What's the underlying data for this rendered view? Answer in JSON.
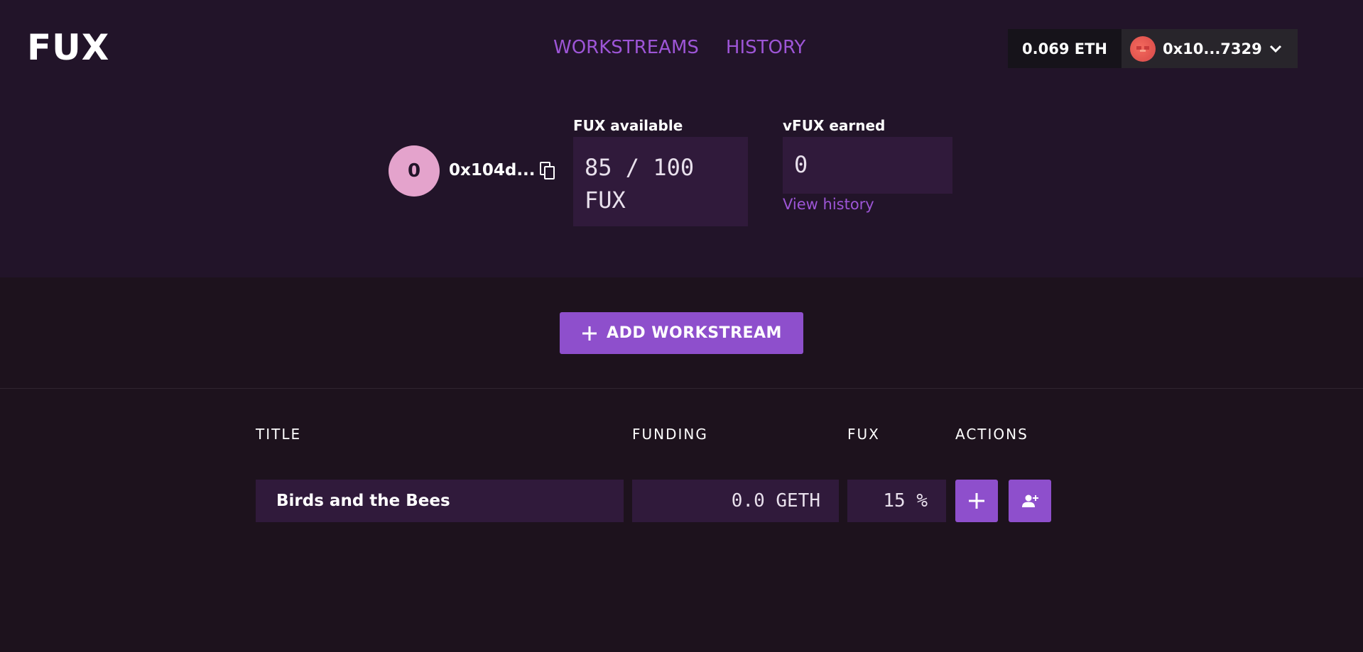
{
  "app": {
    "logo": "FUX"
  },
  "nav": {
    "workstreams": "WORKSTREAMS",
    "history": "HISTORY"
  },
  "wallet": {
    "balance": "0.069 ETH",
    "account": "0x10...7329"
  },
  "profile": {
    "avatar_initial": "0",
    "address": "0x104d..."
  },
  "stats": {
    "fux_label": "FUX available",
    "fux_value": "85 / 100",
    "fux_unit": "FUX",
    "vfux_label": "vFUX earned",
    "vfux_value": "0",
    "view_history": "View history"
  },
  "actions": {
    "add_workstream": "ADD WORKSTREAM"
  },
  "table": {
    "headers": {
      "title": "TITLE",
      "funding": "FUNDING",
      "fux": "FUX",
      "actions": "ACTIONS"
    },
    "rows": [
      {
        "title": "Birds and the Bees",
        "funding": "0.0 GETH",
        "fux": "15 %"
      }
    ]
  },
  "colors": {
    "accent": "#8e4fcc",
    "nav_link": "#9d55d6",
    "header_bg": "#221429",
    "page_bg": "#1d121d",
    "field_bg": "#301a3b",
    "avatar_bg": "#e4a3cc"
  },
  "icons": {
    "copy": "copy-icon",
    "chevron": "chevron-down-icon",
    "plus": "plus-icon",
    "add_user": "add-user-icon",
    "account_avatar": "account-avatar-icon"
  }
}
